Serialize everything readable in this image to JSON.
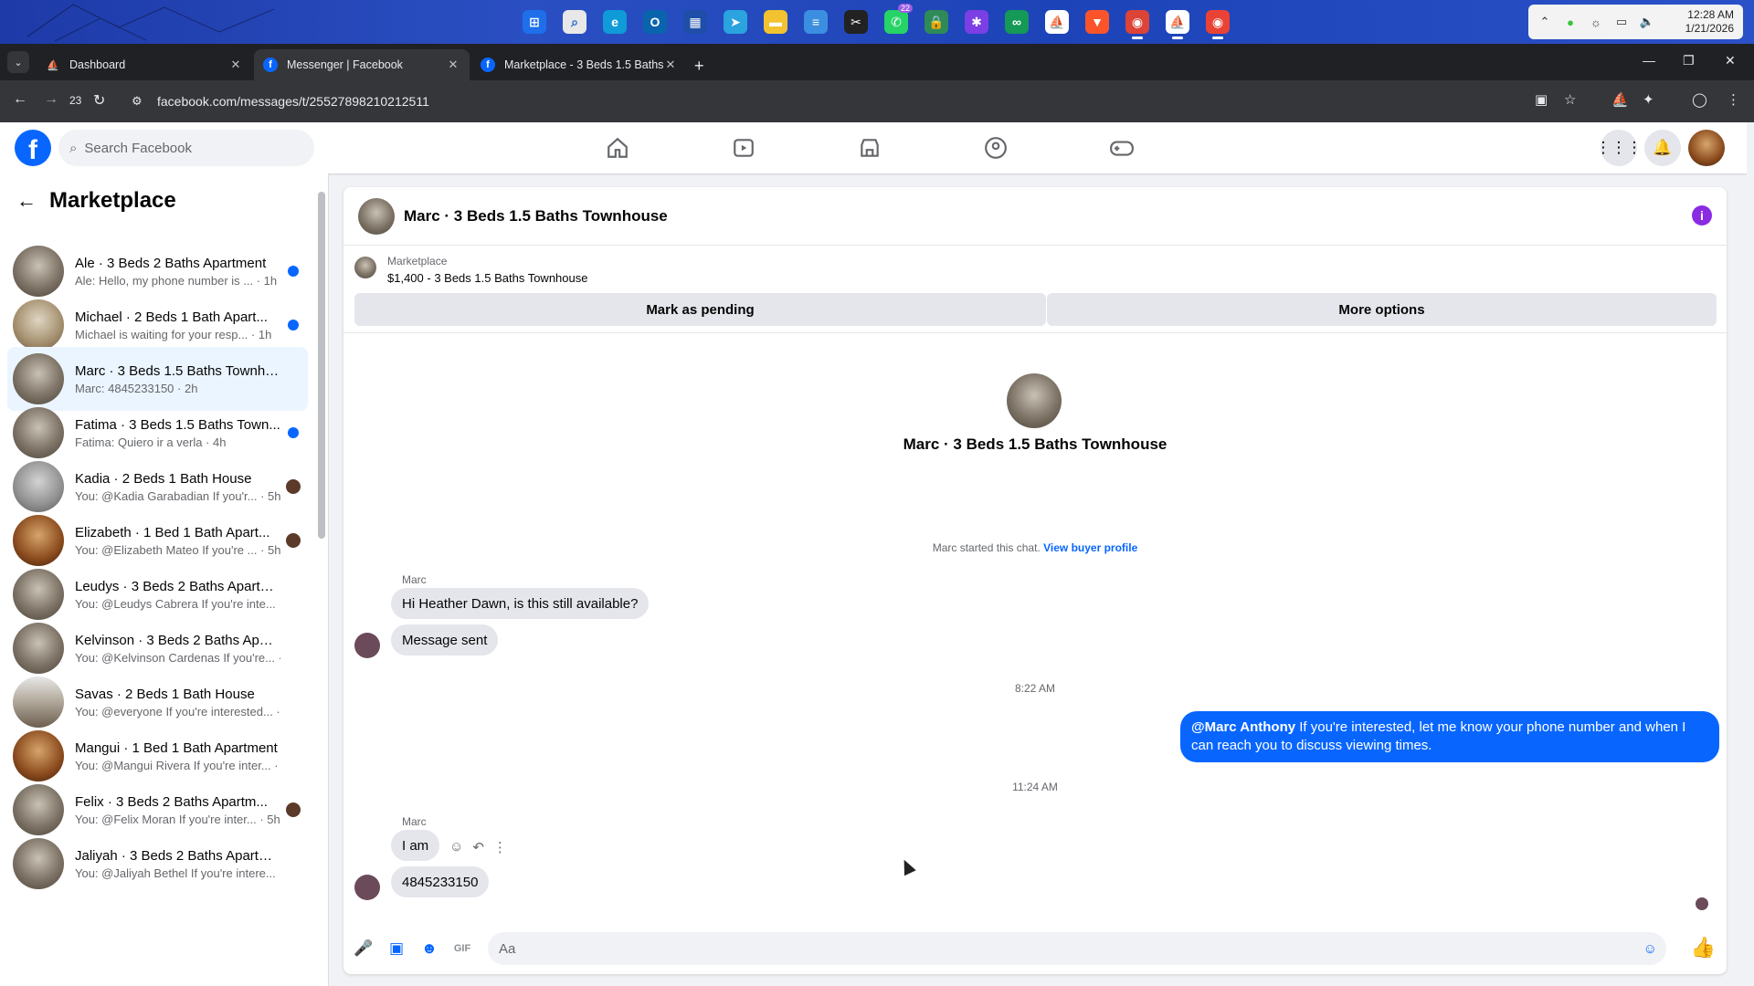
{
  "taskbar": {
    "apps": [
      {
        "icon": "windows-start-icon",
        "color": "#1f6feb",
        "glyph": "⊞"
      },
      {
        "icon": "search-icon",
        "color": "#e8e8e8",
        "glyph": "⌕"
      },
      {
        "icon": "edge-icon",
        "color": "#0f9bd7",
        "glyph": "e"
      },
      {
        "icon": "outlook-icon",
        "color": "#0a64ad",
        "glyph": "O"
      },
      {
        "icon": "store-icon",
        "color": "#1e4ea8",
        "glyph": "▦"
      },
      {
        "icon": "telegram-icon",
        "color": "#2aa3df",
        "glyph": "➤"
      },
      {
        "icon": "file-explorer-icon",
        "color": "#f2c230",
        "glyph": "▬"
      },
      {
        "icon": "notepad-icon",
        "color": "#3b8ee0",
        "glyph": "≡"
      },
      {
        "icon": "capcut-icon",
        "color": "#222222",
        "glyph": "✂"
      },
      {
        "icon": "whatsapp-icon",
        "color": "#25d366",
        "glyph": "✆",
        "badge": "22"
      },
      {
        "icon": "password-manager-icon",
        "color": "#2e8b57",
        "glyph": "🔒"
      },
      {
        "icon": "idea-bulb-icon",
        "color": "#7b3fe4",
        "glyph": "✱"
      },
      {
        "icon": "infinity-app-icon",
        "color": "#159957",
        "glyph": "∞"
      },
      {
        "icon": "sailboat-app-icon",
        "color": "#ffffff",
        "glyph": "⛵"
      },
      {
        "icon": "brave-icon",
        "color": "#fb542b",
        "glyph": "▼"
      },
      {
        "icon": "chrome-icon",
        "color": "#db4437",
        "glyph": "◉"
      },
      {
        "icon": "sailboat-app-2-icon",
        "color": "#ffffff",
        "glyph": "⛵"
      },
      {
        "icon": "chrome-profile-icon",
        "color": "#ea4335",
        "glyph": "◉"
      }
    ],
    "clock_time": "12:28 AM",
    "clock_date": "1/21/2026"
  },
  "browser": {
    "tabs": [
      {
        "title": "Dashboard",
        "favicon": "sailboat-favicon-icon",
        "fav_color": "#1a73e8"
      },
      {
        "title": "Messenger | Facebook",
        "favicon": "facebook-favicon-icon",
        "fav_color": "#0866ff"
      },
      {
        "title": "Marketplace - 3 Beds 1.5 Baths",
        "favicon": "facebook-favicon-icon",
        "fav_color": "#0866ff"
      }
    ],
    "tab_count": "23",
    "url": "facebook.com/messages/t/25527898210212511"
  },
  "fb": {
    "search_placeholder": "Search Facebook",
    "nav": [
      "home-icon",
      "video-icon",
      "marketplace-icon",
      "groups-icon",
      "gaming-icon"
    ]
  },
  "sidebar": {
    "title": "Marketplace",
    "conversations": [
      {
        "name": "Ale · 3 Beds 2 Baths Apartment",
        "preview": "Ale: Hello, my phone number is ... · 1h",
        "unread": true,
        "thumb": "room1"
      },
      {
        "name": "Michael · 2 Beds 1 Bath Apart...",
        "preview": "Michael is waiting for your resp... · 1h",
        "unread": true,
        "thumb": "room2"
      },
      {
        "name": "Marc · 3 Beds 1.5 Baths Townho...",
        "preview": "Marc: 4845233150 · 2h",
        "unread": false,
        "selected": true,
        "thumb": "room1"
      },
      {
        "name": "Fatima · 3 Beds 1.5 Baths Town...",
        "preview": "Fatima: Quiero ir a verla · 4h",
        "unread": true,
        "thumb": "room1"
      },
      {
        "name": "Kadia · 2 Beds 1 Bath House",
        "preview": "You: @Kadia Garabadian If you'r... · 5h",
        "unread": false,
        "avatar": true,
        "thumb": "room3"
      },
      {
        "name": "Elizabeth · 1 Bed 1 Bath Apart...",
        "preview": "You: @Elizabeth Mateo If you're ... · 5h",
        "unread": false,
        "avatar": true,
        "thumb": "room4"
      },
      {
        "name": "Leudys · 3 Beds 2 Baths Apartm...",
        "preview": "You: @Leudys Cabrera If you're inte... · 5h",
        "unread": false,
        "thumb": "room1"
      },
      {
        "name": "Kelvinson · 3 Beds 2 Baths Apart...",
        "preview": "You: @Kelvinson Cardenas If you're... · 5h",
        "unread": false,
        "thumb": "room1"
      },
      {
        "name": "Savas · 2 Beds 1 Bath House",
        "preview": "You: @everyone If you're interested... · 5h",
        "unread": false,
        "thumb": "room5"
      },
      {
        "name": "Mangui · 1 Bed 1 Bath Apartment",
        "preview": "You: @Mangui Rivera If you're inter... · 5h",
        "unread": false,
        "thumb": "room4"
      },
      {
        "name": "Felix · 3 Beds 2 Baths Apartm...",
        "preview": "You: @Felix Moran If you're inter... · 5h",
        "unread": false,
        "avatar": true,
        "thumb": "room1"
      },
      {
        "name": "Jaliyah · 3 Beds 2 Baths Apartme...",
        "preview": "You: @Jaliyah Bethel If you're intere... · 5h",
        "unread": false,
        "thumb": "room1"
      }
    ]
  },
  "chat": {
    "title": "Marc · 3 Beds 1.5 Baths Townhouse",
    "listing_source": "Marketplace",
    "listing_price": "$1,400 - 3 Beds 1.5 Baths Townhouse",
    "mark_pending": "Mark as pending",
    "more_options": "More options",
    "intro_title": "Marc · 3 Beds 1.5 Baths Townhouse",
    "started_text": "Marc started this chat.",
    "buyer_profile_link": "View buyer profile",
    "sender_name": "Marc",
    "msg1": "Hi Heather Dawn, is this still available?",
    "msg2": "Message sent",
    "time1": "8:22 AM",
    "out_mention": "@Marc Anthony",
    "out_text": " If you're interested, let me know your phone number and when I can reach you to discuss viewing times.",
    "time2": "11:24 AM",
    "msg3": "I am",
    "msg4": "4845233150",
    "composer_placeholder": "Aa"
  }
}
